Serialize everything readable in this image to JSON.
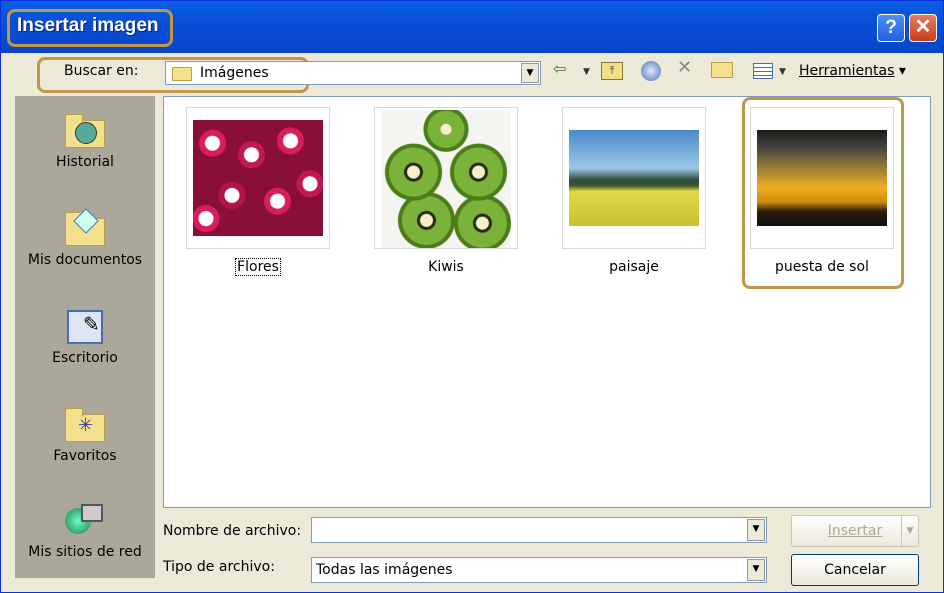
{
  "window": {
    "title": "Insertar imagen"
  },
  "titlebar": {
    "help_glyph": "?",
    "close_glyph": "✕"
  },
  "toolbar": {
    "look_in_label": "Buscar en:",
    "look_in_value": "Imágenes",
    "tools_label": "Herramientas"
  },
  "places": [
    {
      "label": "Historial",
      "icon": "history-icon"
    },
    {
      "label": "Mis documentos",
      "icon": "my-documents-icon"
    },
    {
      "label": "Escritorio",
      "icon": "desktop-icon"
    },
    {
      "label": "Favoritos",
      "icon": "favorites-icon"
    },
    {
      "label": "Mis sitios de red",
      "icon": "network-places-icon"
    }
  ],
  "files": [
    {
      "name": "Flores",
      "type": "flowers"
    },
    {
      "name": "Kiwis",
      "type": "kiwis"
    },
    {
      "name": "paisaje",
      "type": "landscape"
    },
    {
      "name": "puesta de sol",
      "type": "sunset"
    }
  ],
  "footer": {
    "filename_label": "Nombre de archivo:",
    "filename_value": "",
    "filetype_label": "Tipo de archivo:",
    "filetype_value": "Todas las imágenes",
    "insert_label": "Insertar",
    "cancel_label": "Cancelar"
  },
  "colors": {
    "titlebar": "#0A4FD8",
    "highlight": "#C0964A",
    "face": "#ECE9D8"
  }
}
